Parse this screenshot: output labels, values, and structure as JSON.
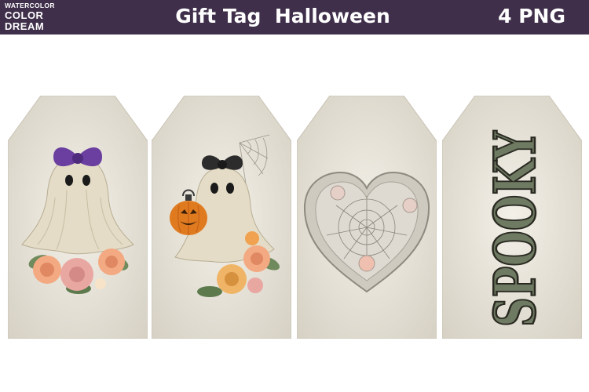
{
  "brand": {
    "line1": "WATERCOLOR",
    "line2": "COLOR",
    "line3": "DREAM"
  },
  "header": {
    "title": "Gift Tag  Halloween",
    "count": "4 PNG",
    "bar_color": "#3f2f4a"
  },
  "tags": [
    {
      "subject": "ghost-with-purple-bow",
      "accent": "#6a3fa0"
    },
    {
      "subject": "ghost-with-pumpkin-lantern",
      "accent": "#e07a1f"
    },
    {
      "subject": "lace-heart-spiderweb",
      "accent": "#9a9a8e"
    },
    {
      "subject": "spooky-lettering",
      "text": "SPOOKY",
      "accent": "#6f7a62"
    }
  ],
  "palette": {
    "tag_paper": "#ebe7dc",
    "ghost": "#e6dcc4",
    "rose_pink": "#e9a7a2",
    "rose_peach": "#f3a981",
    "leaf": "#6f8a5c"
  }
}
